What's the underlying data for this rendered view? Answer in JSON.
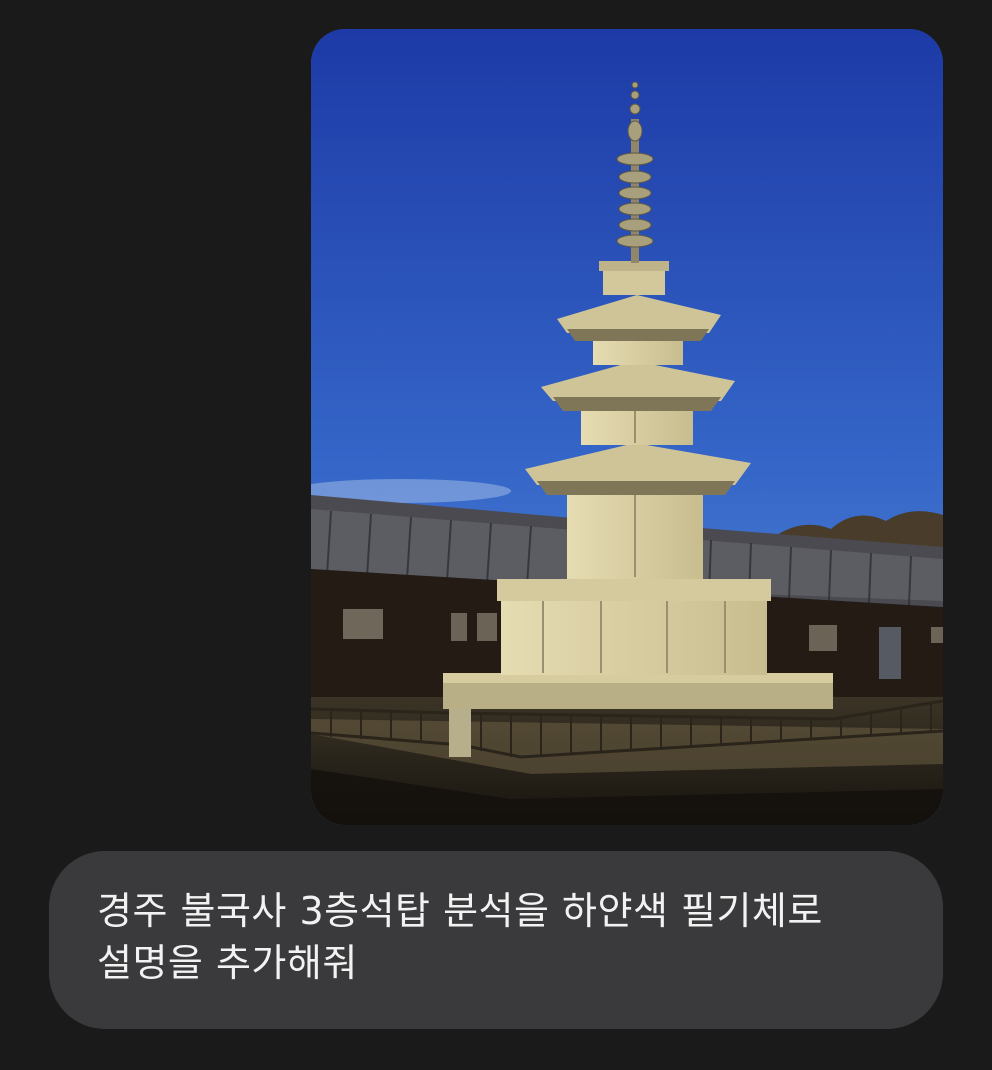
{
  "conversation": {
    "sent_image": {
      "alt": "",
      "colors": {
        "sky_top": "#1f3fae",
        "sky_bottom": "#4f82d6",
        "stone": "#d9cfa3",
        "roof": "#3f3f44"
      }
    },
    "sent_message": {
      "text": "경주 불국사 3층석탑 분석을 하얀색 필기체로\n설명을 추가해줘"
    }
  },
  "theme": {
    "background": "#1a1a1b",
    "bubble_background": "#3a3a3c",
    "text_color": "#f2f2f2"
  }
}
